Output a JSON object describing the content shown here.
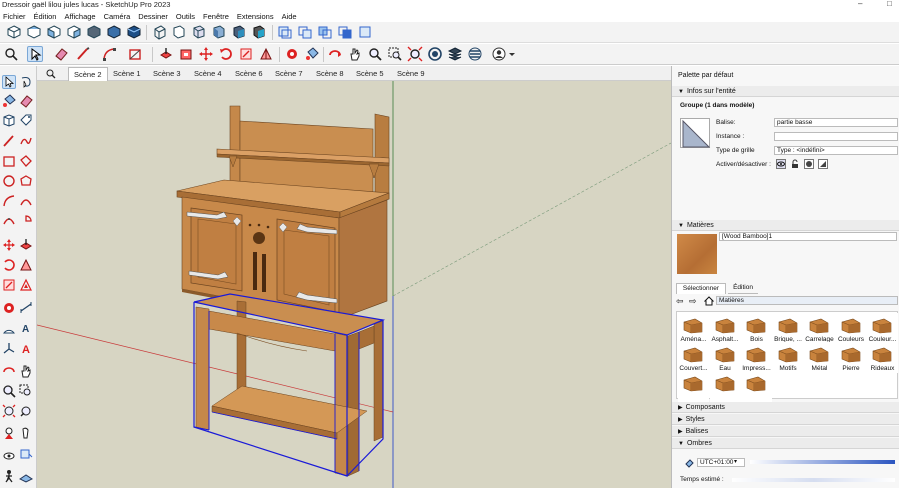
{
  "window": {
    "title": "Dressoir gaël lilou jules lucas - SketchUp Pro 2023"
  },
  "menu": [
    "Fichier",
    "Édition",
    "Affichage",
    "Caméra",
    "Dessiner",
    "Outils",
    "Fenêtre",
    "Extensions",
    "Aide"
  ],
  "scenes": [
    "Scène 2",
    "Scène 1",
    "Scène 3",
    "Scène 4",
    "Scène 6",
    "Scène 7",
    "Scène 8",
    "Scène 5",
    "Scène 9"
  ],
  "tray": {
    "title": "Palette par défaut",
    "entity": {
      "header": "Infos sur l'entité",
      "name": "Groupe (1 dans modèle)",
      "balise_label": "Balise:",
      "balise_value": "partie basse",
      "instance_label": "Instance :",
      "instance_value": "",
      "grid_label": "Type de grille",
      "grid_value": "Type : <indéfini>",
      "toggle_label": "Activer/désactiver :"
    },
    "materials": {
      "header": "Matières",
      "current": "[Wood Bamboo]1",
      "tab_select": "Sélectionner",
      "tab_edit": "Édition",
      "library": "Matières",
      "items": [
        "Aména...",
        "Asphalt...",
        "Bois",
        "Brique, ...",
        "Carrelage",
        "Couleurs",
        "Couleur...",
        "Couvert...",
        "Eau",
        "Impress...",
        "Motifs",
        "Métal",
        "Pierre",
        "Rideaux",
        "",
        "",
        ""
      ]
    },
    "panels": [
      "Composants",
      "Styles",
      "Balises",
      "Ombres"
    ],
    "shadows": {
      "tz": "UTC+01:00",
      "time_label": "Temps estimé :"
    }
  },
  "colors": {
    "sky": "#d7d5c3",
    "wood": "#c98a48",
    "wood_dark": "#9b6630",
    "selection": "#1a1ad8"
  }
}
